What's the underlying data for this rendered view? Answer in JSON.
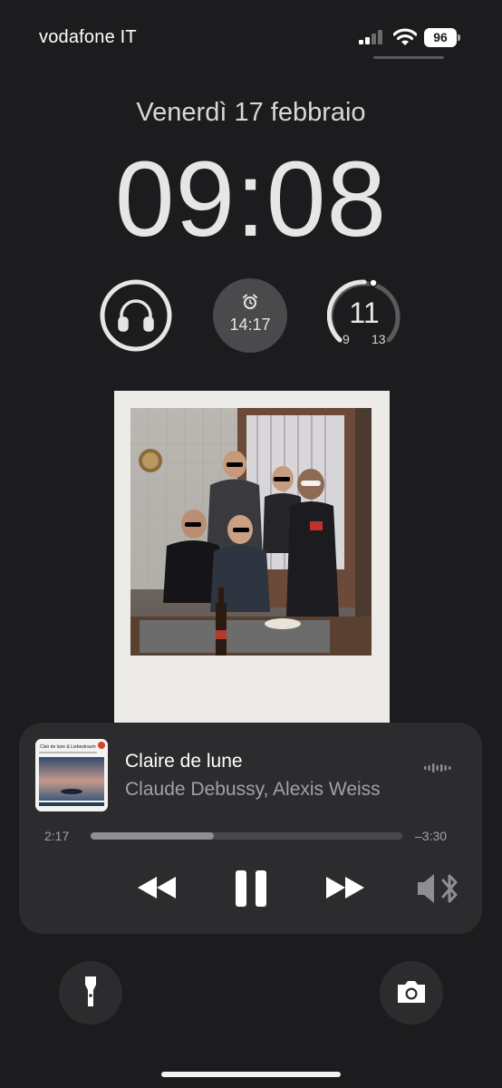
{
  "status_bar": {
    "carrier": "vodafone IT",
    "battery_level": "96",
    "signal_bars_active": 2,
    "signal_bars_total": 4
  },
  "lock_screen": {
    "date": "Venerdì 17 febbraio",
    "time": "09:08"
  },
  "widgets": {
    "headphones": {
      "icon": "headphones-icon",
      "battery_fraction": 1.0
    },
    "alarm": {
      "icon": "alarm-clock-icon",
      "time": "14:17"
    },
    "weather": {
      "current": "11",
      "low": "9",
      "high": "13",
      "position_fraction": 0.5
    }
  },
  "now_playing": {
    "title": "Claire de lune",
    "artist": "Claude Debussy, Alexis Weiss",
    "elapsed": "2:17",
    "remaining": "–3:30",
    "progress_fraction": 0.396,
    "controls": {
      "rewind_icon": "backward-icon",
      "pause_icon": "pause-icon",
      "forward_icon": "forward-icon",
      "route_icon": "speaker-bluetooth-icon"
    },
    "album_art": {
      "title": "Clair de lune & Liebestraum"
    }
  },
  "quick_actions": {
    "left_icon": "flashlight-icon",
    "right_icon": "camera-icon"
  },
  "colors": {
    "background": "#1c1c1e",
    "player_background": "#2c2c2e",
    "secondary_text": "#a1a1a6"
  }
}
